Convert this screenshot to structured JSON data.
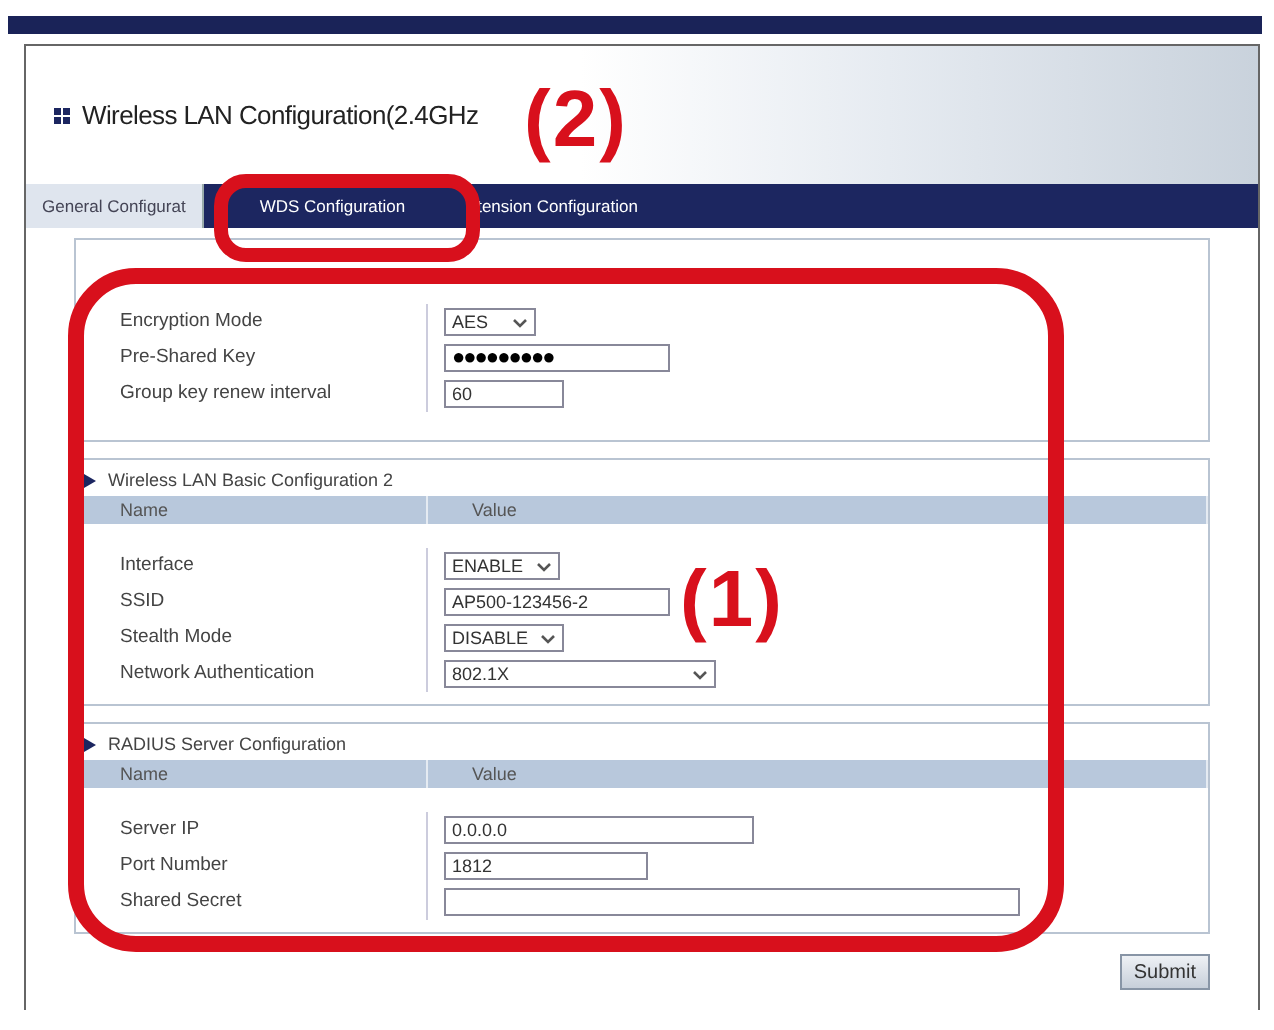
{
  "page": {
    "title": "Wireless LAN Configuration(2.4GHz"
  },
  "tabs": [
    {
      "label": "General Configurat",
      "selected": true
    },
    {
      "label": "WDS Configuration",
      "selected": false
    },
    {
      "label": "tension Configuration",
      "selected": false
    }
  ],
  "sections": [
    {
      "rows": [
        {
          "label": "Encryption Mode",
          "kind": "select",
          "value": "AES"
        },
        {
          "label": "Pre-Shared Key",
          "kind": "password",
          "value": "●●●●●●●●●"
        },
        {
          "label": "Group key renew interval",
          "kind": "text",
          "value": "60"
        }
      ]
    },
    {
      "heading": "Wireless LAN Basic Configuration 2",
      "columns": [
        "Name",
        "Value"
      ],
      "rows": [
        {
          "label": "Interface",
          "kind": "select",
          "value": "ENABLE"
        },
        {
          "label": "SSID",
          "kind": "text",
          "value": "AP500-123456-2"
        },
        {
          "label": "Stealth Mode",
          "kind": "select",
          "value": "DISABLE"
        },
        {
          "label": "Network Authentication",
          "kind": "select",
          "value": "802.1X"
        }
      ]
    },
    {
      "heading": "RADIUS Server Configuration",
      "columns": [
        "Name",
        "Value"
      ],
      "rows": [
        {
          "label": "Server IP",
          "kind": "text",
          "value": "0.0.0.0"
        },
        {
          "label": "Port Number",
          "kind": "text",
          "value": "1812"
        },
        {
          "label": "Shared Secret",
          "kind": "text",
          "value": ""
        }
      ]
    }
  ],
  "submit": "Submit",
  "annotations": [
    {
      "label": "(1)"
    },
    {
      "label": "(2)"
    }
  ]
}
